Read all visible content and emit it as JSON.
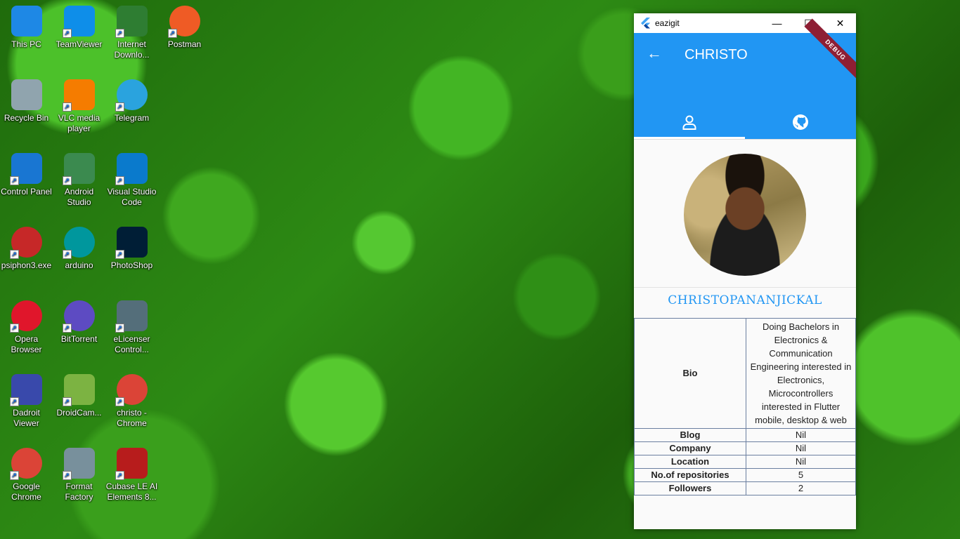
{
  "desktop": {
    "icons": [
      {
        "label": "This PC",
        "icon": "computer-icon",
        "color": "#1e88e5"
      },
      {
        "label": "TeamViewer",
        "icon": "teamviewer-icon",
        "color": "#0e8ee9"
      },
      {
        "label": "Internet Downlo...",
        "icon": "download-manager-icon",
        "color": "#2e7d32"
      },
      {
        "label": "Postman",
        "icon": "postman-icon",
        "color": "#ef5b25"
      },
      {
        "label": "Recycle Bin",
        "icon": "recycle-bin-icon",
        "color": "#90a4ae"
      },
      {
        "label": "VLC media player",
        "icon": "vlc-icon",
        "color": "#f57c00"
      },
      {
        "label": "Telegram",
        "icon": "telegram-icon",
        "color": "#2aa3de"
      },
      {
        "label": "Control Panel",
        "icon": "control-panel-icon",
        "color": "#1976d2"
      },
      {
        "label": "Android Studio",
        "icon": "android-studio-icon",
        "color": "#3b8a4f"
      },
      {
        "label": "Visual Studio Code",
        "icon": "vscode-icon",
        "color": "#0a7acc"
      },
      {
        "label": "psiphon3.exe",
        "icon": "psiphon-icon",
        "color": "#c62828"
      },
      {
        "label": "arduino",
        "icon": "arduino-icon",
        "color": "#00979d"
      },
      {
        "label": "PhotoShop",
        "icon": "photoshop-icon",
        "color": "#001e36"
      },
      {
        "label": "Opera Browser",
        "icon": "opera-icon",
        "color": "#e0162b"
      },
      {
        "label": "BitTorrent",
        "icon": "bittorrent-icon",
        "color": "#5d4bc2"
      },
      {
        "label": "eLicenser Control...",
        "icon": "elicenser-icon",
        "color": "#546e7a"
      },
      {
        "label": "Dadroit Viewer",
        "icon": "dadroit-icon",
        "color": "#3949ab"
      },
      {
        "label": "DroidCam...",
        "icon": "droidcam-icon",
        "color": "#7cb342"
      },
      {
        "label": "christo - Chrome",
        "icon": "chrome-profile-icon",
        "color": "#db4437"
      },
      {
        "label": "Google Chrome",
        "icon": "chrome-icon",
        "color": "#db4437"
      },
      {
        "label": "Format Factory",
        "icon": "format-factory-icon",
        "color": "#78909c"
      },
      {
        "label": "Cubase LE AI Elements 8...",
        "icon": "cubase-icon",
        "color": "#b71c1c"
      }
    ]
  },
  "window": {
    "title": "eazigit",
    "minimize": "—",
    "maximize": "☐",
    "close": "✕"
  },
  "appbar": {
    "back": "←",
    "title": "CHRISTO",
    "debug_banner": "DEBUG",
    "accent": "#2196f3"
  },
  "tabs": [
    {
      "icon": "person-icon",
      "active": true
    },
    {
      "icon": "github-icon",
      "active": false
    }
  ],
  "profile": {
    "name": "CHRISTOPANANJICKAL"
  },
  "info": {
    "bio_label": "Bio",
    "bio_value": "Doing Bachelors in Electronics & Communication Engineering interested in Electronics, Microcontrollers interested in Flutter mobile, desktop & web",
    "blog_label": "Blog",
    "blog_value": "Nil",
    "company_label": "Company",
    "company_value": "Nil",
    "location_label": "Location",
    "location_value": "Nil",
    "repos_label": "No.of repositories",
    "repos_value": "5",
    "followers_label": "Followers",
    "followers_value": "2"
  }
}
